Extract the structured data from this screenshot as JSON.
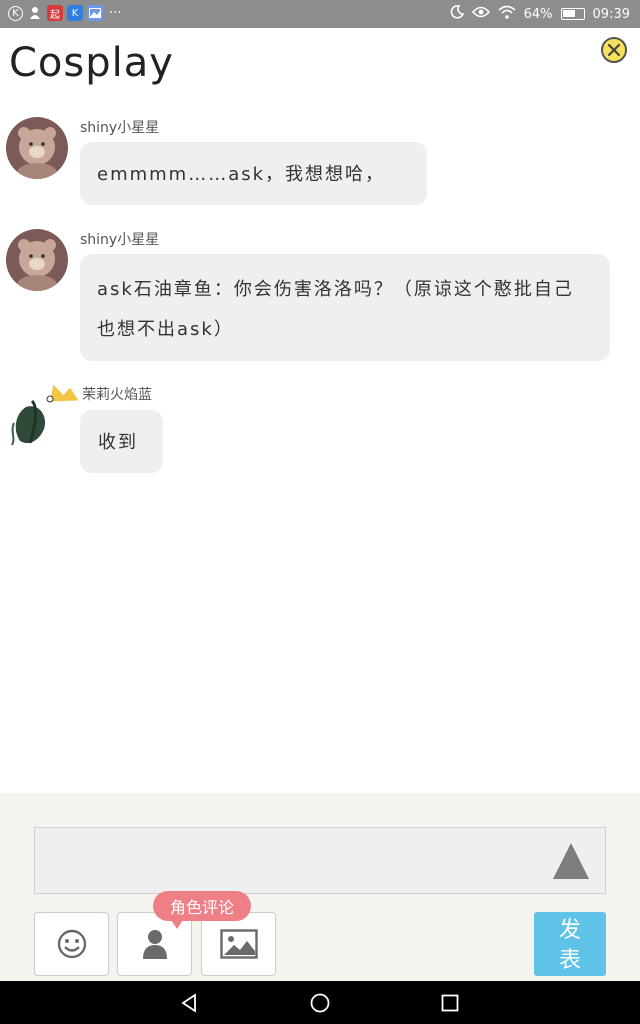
{
  "status_bar": {
    "left_icons": [
      {
        "icon": "k-circle-icon",
        "glyph": "Ⓚ",
        "color": "#8d8d8d"
      },
      {
        "icon": "person-icon",
        "glyph": "♟",
        "color": "#8d8d8d"
      },
      {
        "icon": "qidian-icon",
        "glyph": "起",
        "color": "#d33"
      },
      {
        "icon": "k-app-icon",
        "glyph": "K",
        "color": "#2f7fe0"
      },
      {
        "icon": "gallery-icon",
        "glyph": "▣",
        "color": "#5a8fe0"
      }
    ],
    "more": "···",
    "battery_percent": "64%",
    "battery_level": 0.64,
    "time": "09:39"
  },
  "header": {
    "title": "Cosplay",
    "close_icon": "close-icon"
  },
  "messages": [
    {
      "username": "shiny小星星",
      "text": "emmmm……ask，我想想哈，",
      "avatar": "teddy-bear-avatar"
    },
    {
      "username": "shiny小星星",
      "text": "ask石油章鱼：你会伤害洛洛吗？（原谅这个憨批自己也想不出ask）",
      "avatar": "teddy-bear-avatar"
    },
    {
      "username": "茉莉火焰蓝",
      "text": "收到",
      "avatar": "plant-crown-avatar"
    }
  ],
  "composer": {
    "input_value": "",
    "tooltip": "角色评论",
    "post_label": "发表",
    "tools": [
      "emoji-icon",
      "role-icon",
      "image-icon"
    ]
  },
  "colors": {
    "status_bar": "#8d8d8d",
    "composer_bg": "#f4f3ee",
    "bubble": "#efefef",
    "tooltip": "#ee7f86",
    "post_button": "#5ec3e6",
    "close_button": "#f5e25a"
  }
}
